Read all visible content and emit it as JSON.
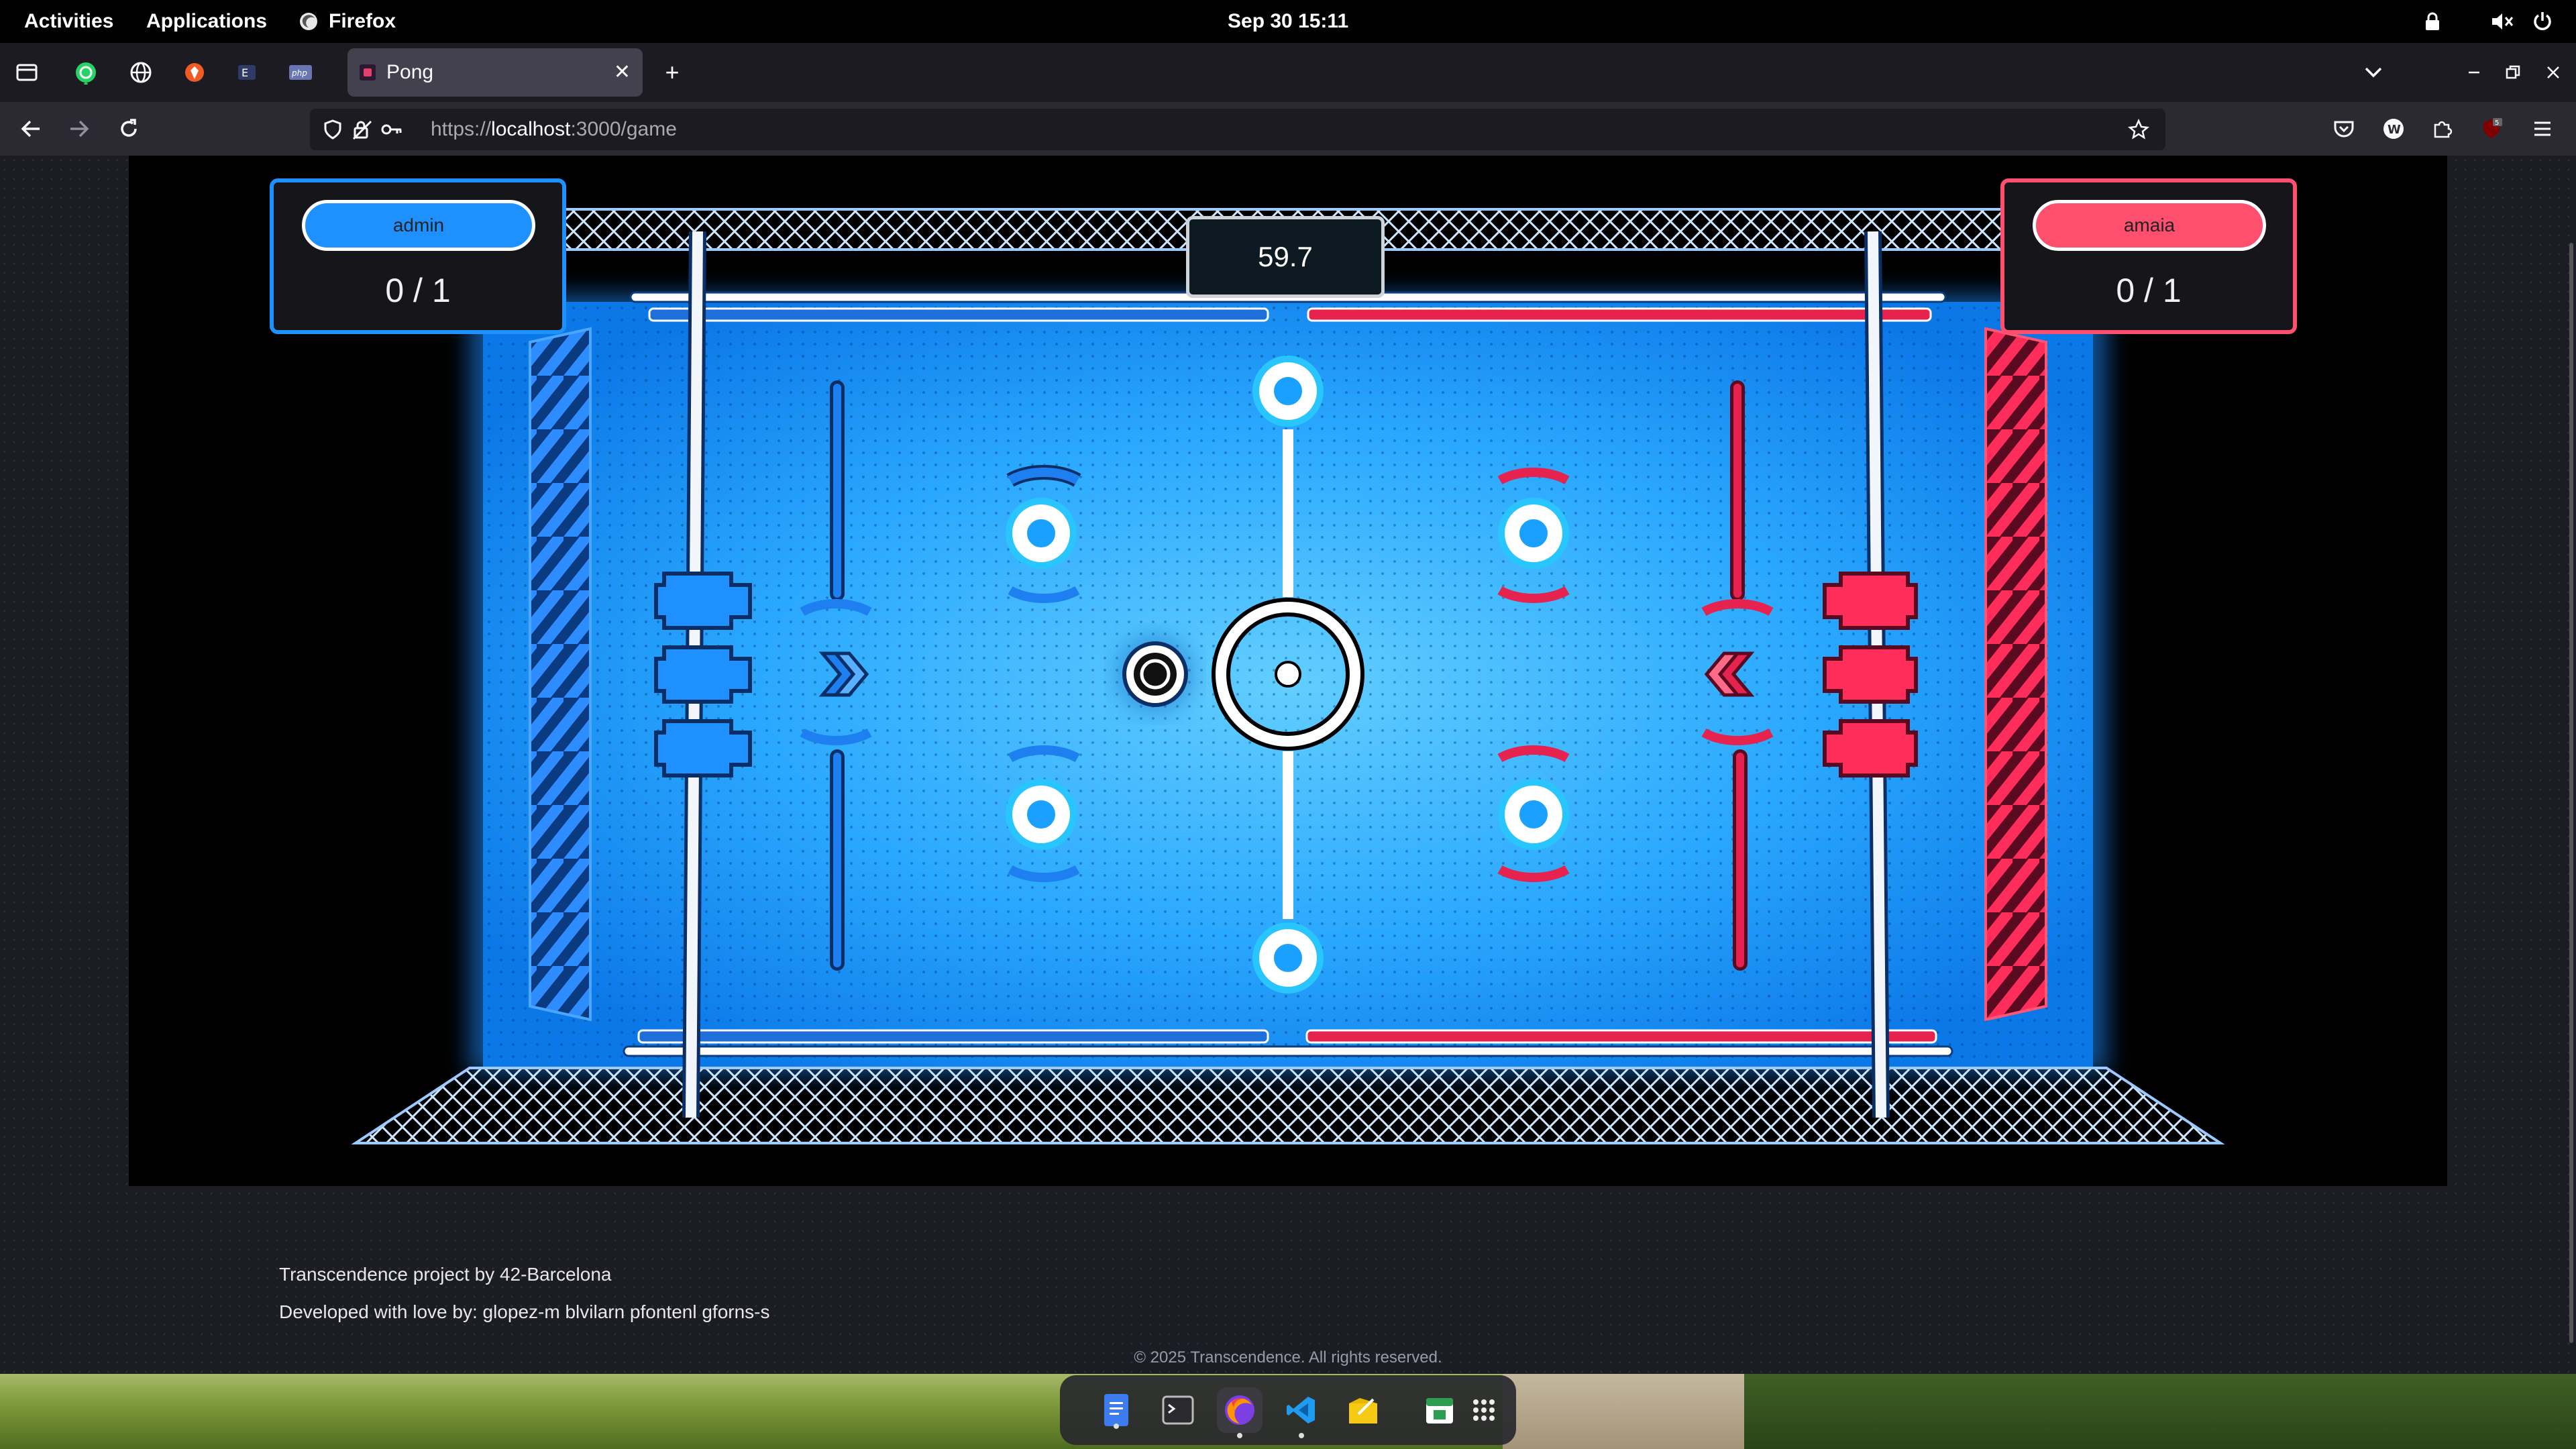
{
  "topbar": {
    "activities": "Activities",
    "applications": "Applications",
    "browser_name": "Firefox",
    "datetime": "Sep 30  15:11"
  },
  "tabs": {
    "active_title": "Pong"
  },
  "navbar": {
    "url_scheme": "https://",
    "url_host": "localhost",
    "url_path": ":3000/game"
  },
  "game": {
    "player_left": {
      "name": "admin",
      "score": "0 / 1",
      "color": "#1e90ff"
    },
    "player_right": {
      "name": "amaia",
      "score": "0 / 1",
      "color": "#ff4f6e"
    },
    "timer": "59.7"
  },
  "footer": {
    "line1": "Transcendence project by 42-Barcelona",
    "line2": "Developed with love by: glopez-m blvilarn pfontenl gforns-s",
    "copyright": "© 2025 Transcendence. All rights reserved."
  },
  "colors": {
    "accent_blue": "#1e90ff",
    "accent_red": "#ff4f6e",
    "field_blue": "#2aa8ff"
  },
  "icons": {
    "pinned_tabs": [
      "whatsapp-icon",
      "globe-icon",
      "brave-icon",
      "element-icon",
      "php-icon"
    ],
    "dock": [
      "files-icon",
      "terminal-icon",
      "firefox-icon",
      "vscode-icon",
      "notes-icon",
      "calendar-icon",
      "app-grid-icon"
    ]
  }
}
